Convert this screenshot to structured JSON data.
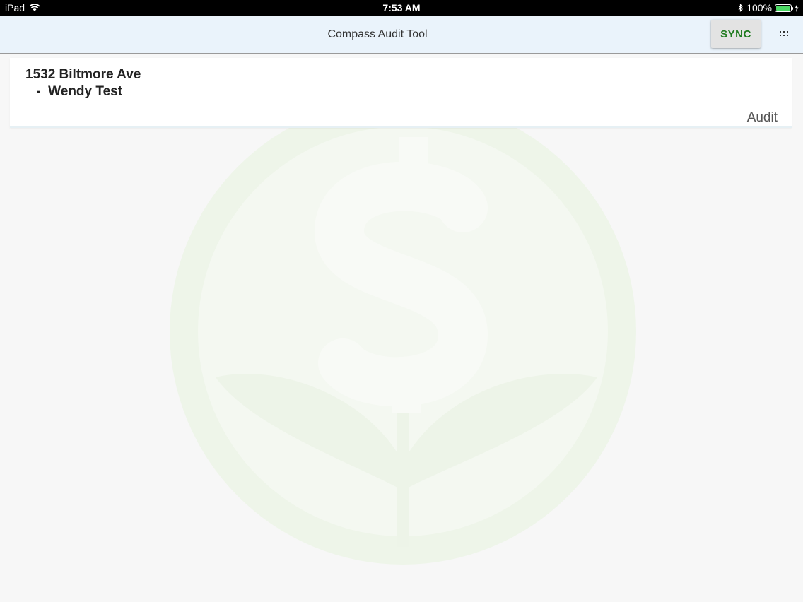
{
  "status_bar": {
    "device": "iPad",
    "time": "7:53 AM",
    "battery": "100%"
  },
  "app_bar": {
    "title": "Compass Audit Tool",
    "sync_label": "SYNC",
    "menu_icon": "more-dots-icon"
  },
  "list": {
    "items": [
      {
        "address": "1532 Biltmore Ave",
        "name": " -  Wendy Test",
        "action_label": "Audit"
      }
    ]
  },
  "colors": {
    "accent": "#1e7a1e",
    "app_bar_bg": "#eaf3fb",
    "watermark": "#eef5e9"
  }
}
